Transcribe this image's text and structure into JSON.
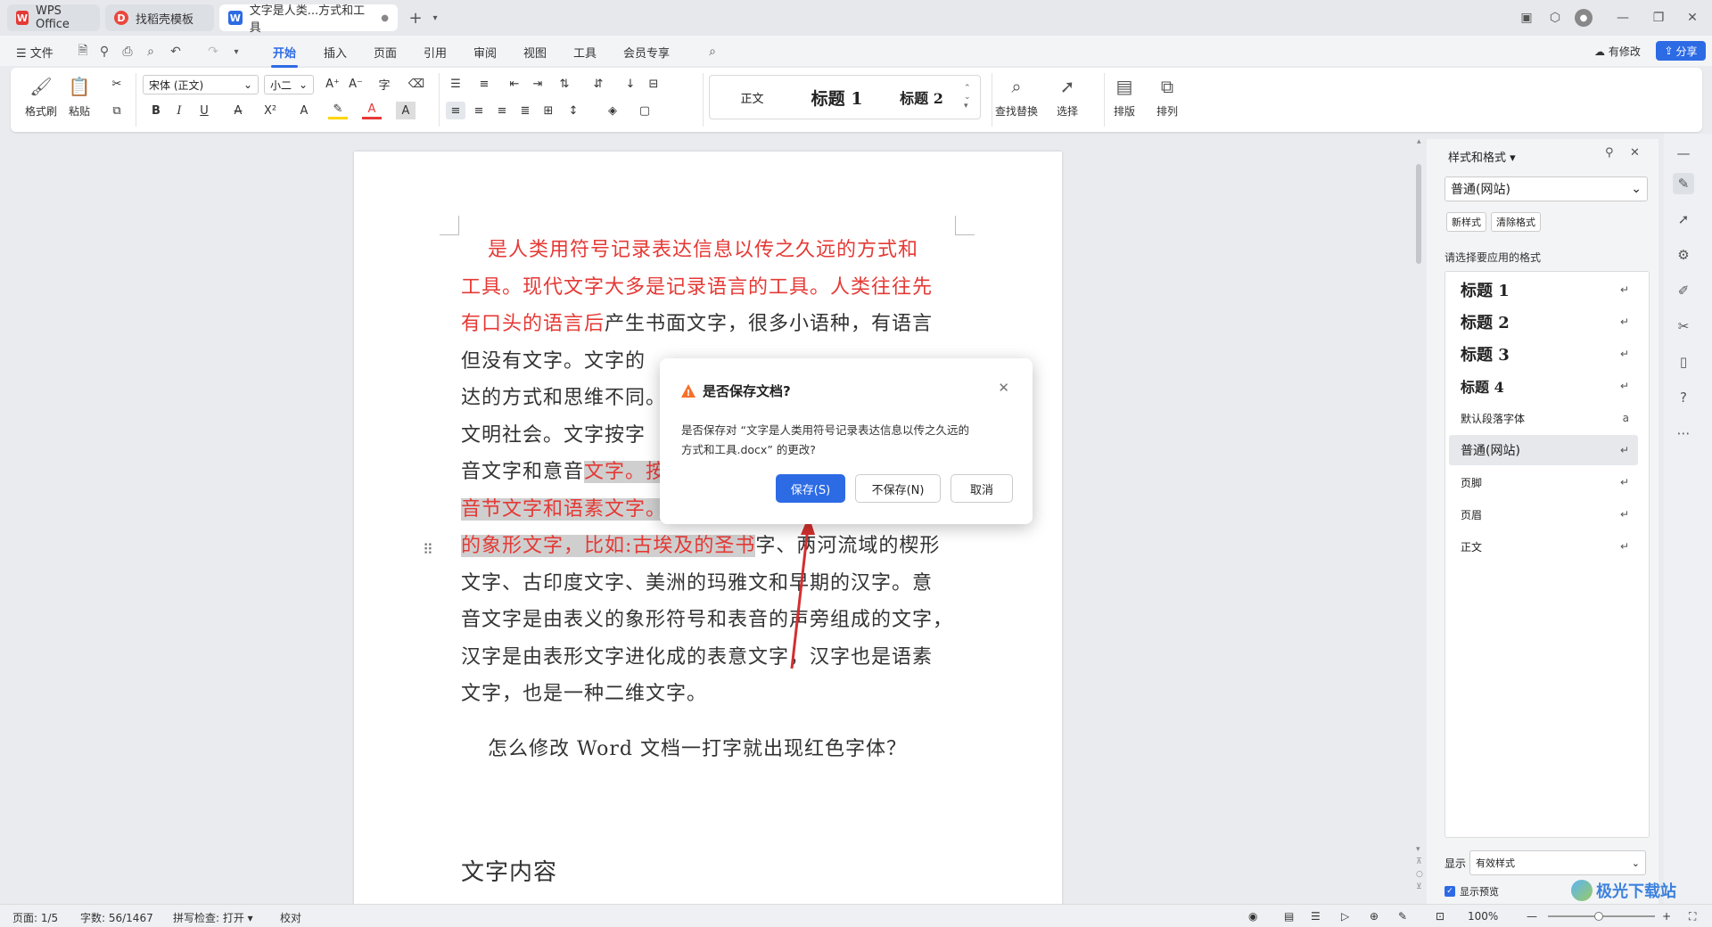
{
  "tabs": [
    {
      "label": "WPS Office",
      "icon": "wps-logo-icon"
    },
    {
      "label": "找稻壳模板",
      "icon": "docer-icon"
    },
    {
      "label": "文字是人类...方式和工具",
      "icon": "writer-doc-icon"
    }
  ],
  "menu": {
    "file": "文件",
    "items": [
      "开始",
      "插入",
      "页面",
      "引用",
      "审阅",
      "视图",
      "工具",
      "会员专享"
    ],
    "active": "开始",
    "has_changes": "有修改",
    "share": "分享"
  },
  "ribbon": {
    "format_painter": "格式刷",
    "paste": "粘贴",
    "font_name": "宋体 (正文)",
    "font_size": "小二",
    "styles": [
      "正文",
      "标题 1",
      "标题 2"
    ],
    "find_replace": "查找替换",
    "select": "选择",
    "layout": "排版",
    "arrange": "排列"
  },
  "document": {
    "lines": [
      {
        "segments": [
          {
            "text": "是人类用符号记录表达信息以传之久远的方式和",
            "style": "red"
          }
        ],
        "indent": true
      },
      {
        "segments": [
          {
            "text": "工具。现代文字大多是记录语言的工具。人类往往先",
            "style": "red"
          }
        ]
      },
      {
        "segments": [
          {
            "text": "有口头的语言后",
            "style": "red"
          },
          {
            "text": "产生书面文字，很多小语种，有语言",
            "style": "normal"
          }
        ]
      },
      {
        "segments": [
          {
            "text": "但没有文字。文字的",
            "style": "normal"
          }
        ]
      },
      {
        "segments": [
          {
            "text": "达的方式和思维不同。",
            "style": "normal"
          }
        ]
      },
      {
        "segments": [
          {
            "text": "文明社会。文字按字",
            "style": "normal"
          }
        ]
      },
      {
        "segments": [
          {
            "text": "音文字和意音",
            "style": "normal"
          },
          {
            "text": "文字。按",
            "style": "red-hl"
          }
        ]
      },
      {
        "segments": [
          {
            "text": "音节文字和语素文字。",
            "style": "red-hl"
          }
        ]
      },
      {
        "segments": [
          {
            "text": "的象形文字，比如:古埃及的圣书",
            "style": "red-hl"
          },
          {
            "text": "字、两河流域的楔形",
            "style": "normal"
          }
        ]
      },
      {
        "segments": [
          {
            "text": "文字、古印度文字、美洲的玛雅文和早期的汉字。意",
            "style": "normal"
          }
        ]
      },
      {
        "segments": [
          {
            "text": "音文字是由表义的象形符号和表音的声旁组成的文字，",
            "style": "normal"
          }
        ]
      },
      {
        "segments": [
          {
            "text": "汉字是由表形文字进化成的表意文字，汉字也是语素",
            "style": "normal"
          }
        ]
      },
      {
        "segments": [
          {
            "text": "文字，也是一种二维文字。",
            "style": "normal"
          }
        ]
      }
    ],
    "question": "怎么修改 Word 文档一打字就出现红色字体？",
    "heading": "文字内容"
  },
  "dialog": {
    "title": "是否保存文档?",
    "message_line1": "是否保存对 “文字是人类用符号记录表达信息以传之久远的",
    "message_line2": "方式和工具.docx” 的更改?",
    "save": "保存(S)",
    "dont_save": "不保存(N)",
    "cancel": "取消"
  },
  "panel": {
    "title": "样式和格式",
    "current_style": "普通(网站)",
    "new_style": "新样式",
    "clear_format": "清除格式",
    "apply_label": "请选择要应用的格式",
    "styles": [
      {
        "name": "标题  1",
        "kind": "h"
      },
      {
        "name": "标题  2",
        "kind": "h"
      },
      {
        "name": "标题  3",
        "kind": "h"
      },
      {
        "name": "标题  4",
        "kind": "h4"
      },
      {
        "name": "默认段落字体",
        "kind": "small"
      },
      {
        "name": "普通(网站)",
        "kind": "selected"
      },
      {
        "name": "页脚",
        "kind": "small"
      },
      {
        "name": "页眉",
        "kind": "small"
      },
      {
        "name": "正文",
        "kind": "small"
      }
    ],
    "show_label": "显示",
    "show_value": "有效样式",
    "preview_label": "显示预览"
  },
  "status": {
    "page": "页面: 1/5",
    "words": "字数: 56/1467",
    "spell": "拼写检查: 打开",
    "proof": "校对",
    "zoom": "100%"
  },
  "watermark": "极光下载站",
  "colors": {
    "accent": "#2d6be5",
    "red_text": "#e53935",
    "warn": "#f5712b"
  }
}
